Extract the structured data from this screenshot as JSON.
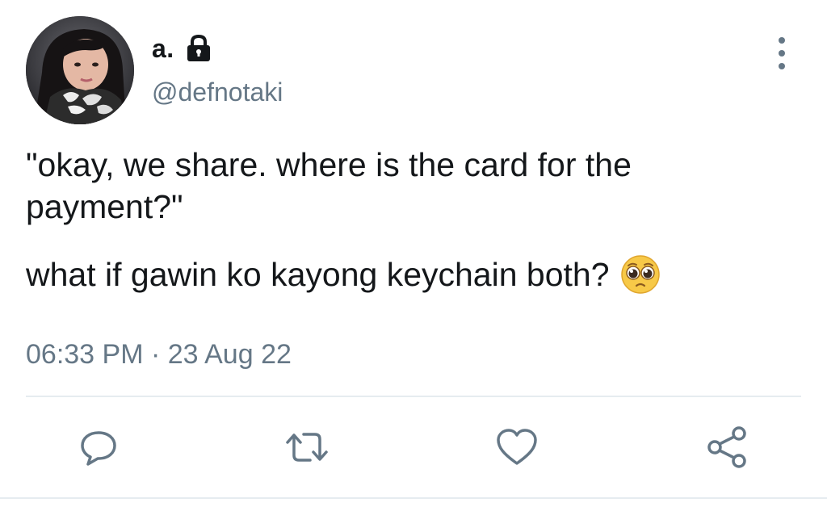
{
  "user": {
    "display_name": "a.",
    "handle": "@defnotaki",
    "protected": true,
    "avatar_description": "profile photo"
  },
  "tweet": {
    "paragraph_one": "\"okay, we share. where is the card for the payment?\"",
    "paragraph_two": "what if gawin ko kayong keychain both?",
    "emoji": "pleading-face-emoji",
    "timestamp": "06:33 PM · 23 Aug 22"
  },
  "actions": [
    {
      "icon": "reply-icon"
    },
    {
      "icon": "retweet-icon"
    },
    {
      "icon": "like-icon"
    },
    {
      "icon": "share-icon"
    }
  ],
  "colors": {
    "text_primary": "#14171a",
    "text_secondary": "#657786",
    "divider": "#e6ecf0",
    "emoji_yellow": "#f7c948"
  }
}
